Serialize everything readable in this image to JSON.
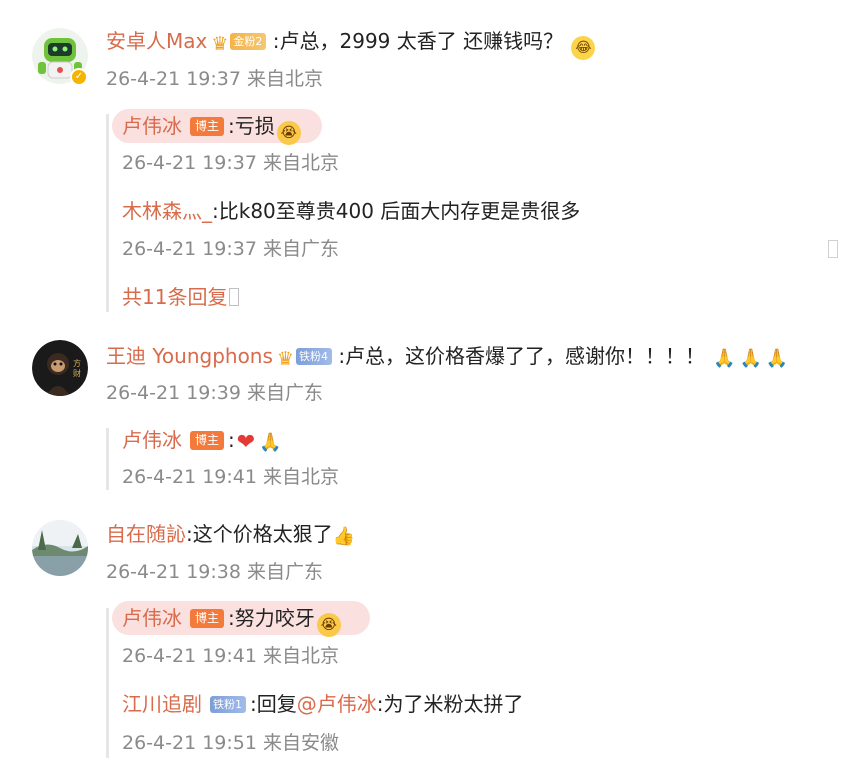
{
  "comments": [
    {
      "user": "安卓人Max",
      "fan_badge": "金粉2",
      "text": ":卢总，2999 太香了 还赚钱吗？",
      "meta": "26-4-21 19:37 来自北京",
      "replies": [
        {
          "user": "卢伟冰",
          "host_badge": "博主",
          "text": ":亏损",
          "meta": "26-4-21 19:37 来自北京"
        },
        {
          "user": "木林森灬_",
          "text": ":比k80至尊贵400 后面大内存更是贵很多",
          "meta": "26-4-21 19:37 来自广东"
        }
      ],
      "more_replies": "共11条回复"
    },
    {
      "user": "王迪 Youngphons",
      "fan_badge": "铁粉4",
      "text": ":卢总，这价格香爆了了，感谢你！！！！",
      "meta": "26-4-21 19:39 来自广东",
      "replies": [
        {
          "user": "卢伟冰",
          "host_badge": "博主",
          "text": ":",
          "meta": "26-4-21 19:41 来自北京"
        }
      ]
    },
    {
      "user": "自在随訫",
      "text": ":这个价格太狠了",
      "meta": "26-4-21 19:38 来自广东",
      "replies": [
        {
          "user": "卢伟冰",
          "host_badge": "博主",
          "text": ":努力咬牙",
          "meta": "26-4-21 19:41 来自北京"
        },
        {
          "user": "江川追剧",
          "fan_badge": "铁粉1",
          "text_prefix": ":回复",
          "mention": "@卢伟冰",
          "text": ":为了米粉太拼了",
          "meta": "26-4-21 19:51 来自安徽"
        }
      ]
    }
  ],
  "colors": {
    "username": "#d86b4b",
    "meta": "#8a8a8a",
    "host_badge_bg": "#f47a3c",
    "pill_bg": "#fbe0e0",
    "gold_fan": "#f5b24a",
    "iron_fan": "#7d9ed9"
  },
  "icons": {
    "laugh": "laughing-tears-emoji",
    "cry": "crying-emoji",
    "pray": "praying-hands-emoji",
    "heart": "red-heart-emoji",
    "thumb": "thumbs-up-emoji",
    "crown": "crown-icon",
    "verified": "verified-badge-icon"
  }
}
